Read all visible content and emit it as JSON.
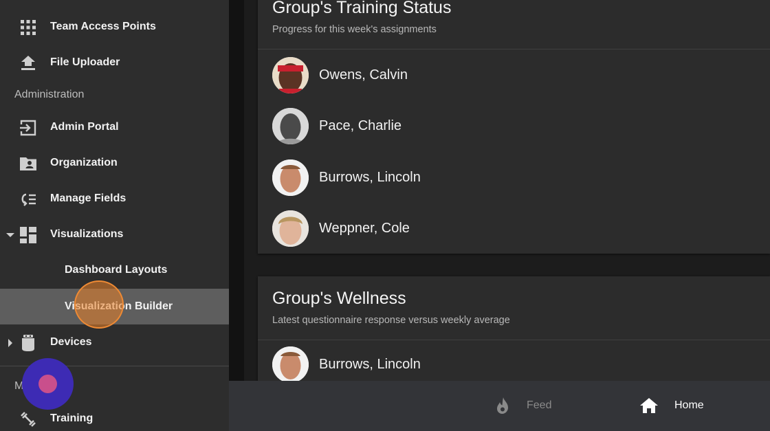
{
  "sidebar": {
    "items": [
      {
        "label": "Team Access Points",
        "icon": "apps-grid-icon"
      },
      {
        "label": "File Uploader",
        "icon": "upload-icon"
      },
      {
        "label": "Admin Portal",
        "icon": "login-arrow-icon"
      },
      {
        "label": "Organization",
        "icon": "folder-account-icon"
      },
      {
        "label": "Manage Fields",
        "icon": "list-return-icon"
      },
      {
        "label": "Visualizations",
        "icon": "dashboard-icon"
      },
      {
        "label": "Dashboard Layouts"
      },
      {
        "label": "Visualization Builder"
      },
      {
        "label": "Devices",
        "icon": "device-icon"
      },
      {
        "label": "Training",
        "icon": "dumbbell-icon"
      }
    ],
    "section_administration": "Administration",
    "section_partial": "M"
  },
  "training_card": {
    "title": "Group's Training Status",
    "subtitle": "Progress for this week's assignments",
    "people": [
      {
        "name": "Owens, Calvin"
      },
      {
        "name": "Pace, Charlie"
      },
      {
        "name": "Burrows, Lincoln"
      },
      {
        "name": "Weppner, Cole"
      }
    ]
  },
  "wellness_card": {
    "title": "Group's Wellness",
    "subtitle": "Latest questionnaire response versus weekly average",
    "people": [
      {
        "name": "Burrows, Lincoln"
      }
    ]
  },
  "bottom_nav": {
    "feed_label": "Feed",
    "home_label": "Home"
  },
  "colors": {
    "sidebar_bg": "#2d2d2d",
    "active_item_bg": "#5e5e5e",
    "card_bg": "#2c2c2c",
    "bottom_bar_bg": "#333438",
    "home_active": "#ffffff",
    "feed_inactive": "#8a8a8a"
  }
}
